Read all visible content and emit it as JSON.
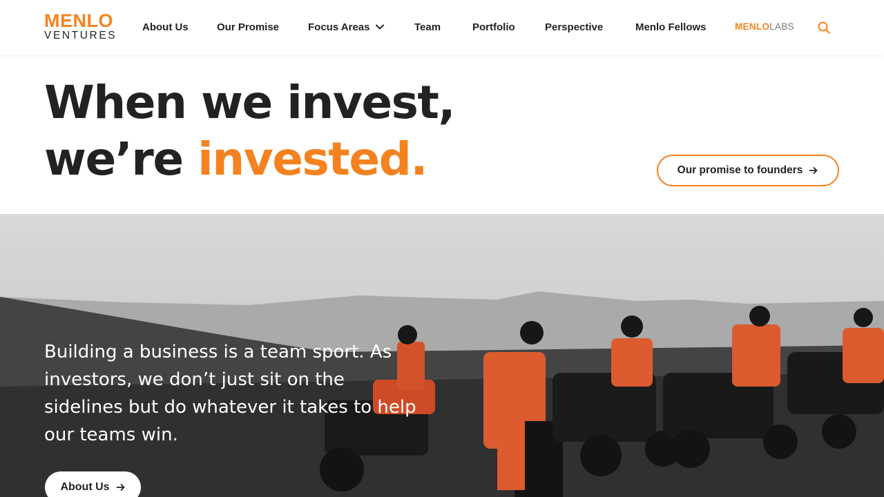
{
  "brand": {
    "logo_top": "MENLO",
    "logo_bottom": "VENTURES",
    "accent_color": "#f58220",
    "text_color": "#222222"
  },
  "nav": {
    "items": [
      {
        "label": "About Us"
      },
      {
        "label": "Our Promise"
      },
      {
        "label": "Focus Areas",
        "icon": "chevron-down-icon"
      },
      {
        "label": "Team"
      },
      {
        "label": "Portfolio"
      },
      {
        "label": "Perspective"
      },
      {
        "label": "Menlo Fellows"
      }
    ],
    "labs_part1": "MENLO",
    "labs_part2": "LABS",
    "search_icon": "search-icon"
  },
  "hero": {
    "line1": "When we invest,",
    "line2_plain": "we’re ",
    "line2_accent": "invested.",
    "promise_button": "Our promise to founders"
  },
  "photo_section": {
    "text": "Building a business is a team sport. As investors, we don’t just sit on the sidelines but do whatever it takes to help our teams win.",
    "button": "About Us"
  }
}
